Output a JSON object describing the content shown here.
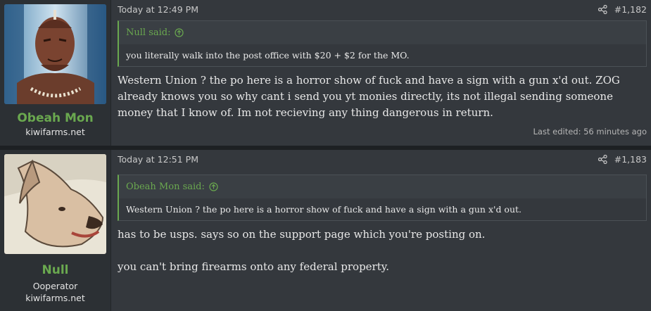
{
  "posts": [
    {
      "username": "Obeah Mon",
      "user_banner": "kiwifarms.net",
      "date": "Today at 12:49 PM",
      "post_number": "#1,182",
      "quote": {
        "author": "Null said:",
        "text": "you literally walk into the post office with $20 + $2 for the MO."
      },
      "message": "Western Union ? the po here is a horror show of fuck and have a sign with a gun x'd out. ZOG already knows you so why cant i send you yt monies directly, its not illegal sending someone money that I know of. Im not recieving any thing dangerous in return.",
      "last_edited": "Last edited: 56 minutes ago"
    },
    {
      "username": "Null",
      "user_title": "Ooperator",
      "user_banner": "kiwifarms.net",
      "date": "Today at 12:51 PM",
      "post_number": "#1,183",
      "quote": {
        "author": "Obeah Mon said:",
        "text": "Western Union ? the po here is a horror show of fuck and have a sign with a gun x'd out."
      },
      "message_lines": [
        "has to be usps. says so on the support page which you're posting on.",
        "you can't bring firearms onto any federal property."
      ]
    }
  ],
  "colors": {
    "accent": "#6aa84f",
    "post_bg": "#34383d",
    "user_cell_bg": "#2c3034",
    "page_bg": "#1d2023"
  },
  "icons": {
    "share": "share-icon",
    "quote_jump": "arrow-up-icon"
  }
}
